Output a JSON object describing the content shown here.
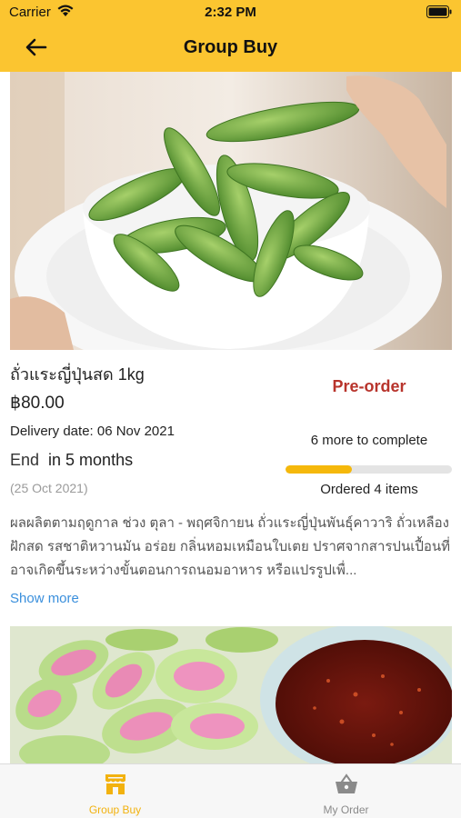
{
  "status_bar": {
    "carrier": "Carrier",
    "time": "2:32 PM"
  },
  "header": {
    "title": "Group Buy",
    "back_icon": "arrow-left-icon"
  },
  "product": {
    "title": "ถั่วแระญี่ปุ่นสด 1kg",
    "price": "฿80.00",
    "delivery": "Delivery date: 06 Nov 2021",
    "end_label": "End",
    "end_value": "in 5 months",
    "end_date": "(25 Oct 2021)",
    "badge": "Pre-order",
    "more_to_complete": "6 more to complete",
    "progress_fraction": 0.4,
    "ordered": "Ordered 4 items",
    "description": "ผลผลิตตามฤดูกาล ช่วง ตุลา - พฤศจิกายน ถั่วแระญี่ปุ่นพันธุ์คาวาริ ถั่วเหลืองฝักสด รสชาติหวานมัน อร่อย กลิ่นหอมเหมือนใบเตย ปราศจากสารปนเปื้อนที่อาจเกิดขึ้นระหว่างขั้นตอนการถนอมอาหาร หรือแปรรูปเพื่...",
    "show_more": "Show more"
  },
  "tabs": [
    {
      "label": "Group Buy",
      "icon": "store-icon",
      "active": true
    },
    {
      "label": "My Order",
      "icon": "basket-icon",
      "active": false
    }
  ],
  "colors": {
    "header_bg": "#fbc530",
    "badge": "#b8342c",
    "progress": "#f5b80b",
    "link": "#3a8fdc",
    "tab_active": "#f2b20f",
    "tab_inactive": "#8a8a8a"
  }
}
